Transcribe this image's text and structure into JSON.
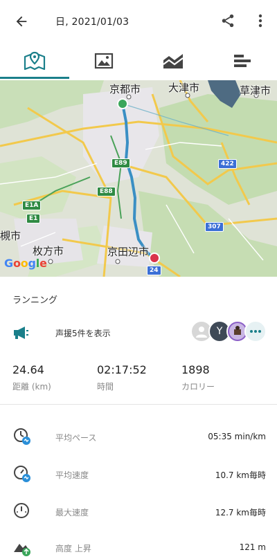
{
  "header": {
    "title": "日, 2021/01/03",
    "back_icon": "arrow-left-icon",
    "share_icon": "share-icon",
    "more_icon": "more-vertical-icon"
  },
  "tabs": [
    {
      "icon": "map-pin-icon",
      "active": true
    },
    {
      "icon": "image-icon",
      "active": false
    },
    {
      "icon": "chart-icon",
      "active": false
    },
    {
      "icon": "bars-icon",
      "active": false
    }
  ],
  "map": {
    "labels": {
      "kyoto": "京都市",
      "otsu": "大津市",
      "kusatsu": "草津市",
      "hirakata": "枚方市",
      "kyotanabe": "京田辺市",
      "edge": "槻市"
    },
    "shields": {
      "e89": "E89",
      "e88": "E88",
      "e1a": "E1A",
      "e1": "E1",
      "r422": "422",
      "r307": "307",
      "r24": "24"
    },
    "google": "Google"
  },
  "activity": {
    "type": "ランニング",
    "cheer_text": "声援5件を表示",
    "avatar_letter": "Y"
  },
  "stats": {
    "distance": {
      "value": "24.64",
      "label": "距離 (km)"
    },
    "time": {
      "value": "02:17:52",
      "label": "時間"
    },
    "calories": {
      "value": "1898",
      "label": "カロリー"
    }
  },
  "metrics": [
    {
      "name": "平均ペース",
      "value": "05:35 min/km",
      "icon": "pace-icon"
    },
    {
      "name": "平均速度",
      "value": "10.7 km毎時",
      "icon": "speedometer-icon"
    },
    {
      "name": "最大速度",
      "value": "12.7 km毎時",
      "icon": "max-speed-icon"
    },
    {
      "name": "高度 上昇",
      "value": "121 m",
      "icon": "elevation-icon"
    }
  ],
  "colors": {
    "accent": "#1a7f8a",
    "route": "#3a8fc4",
    "start": "#3aa65a",
    "end": "#d9334a"
  }
}
